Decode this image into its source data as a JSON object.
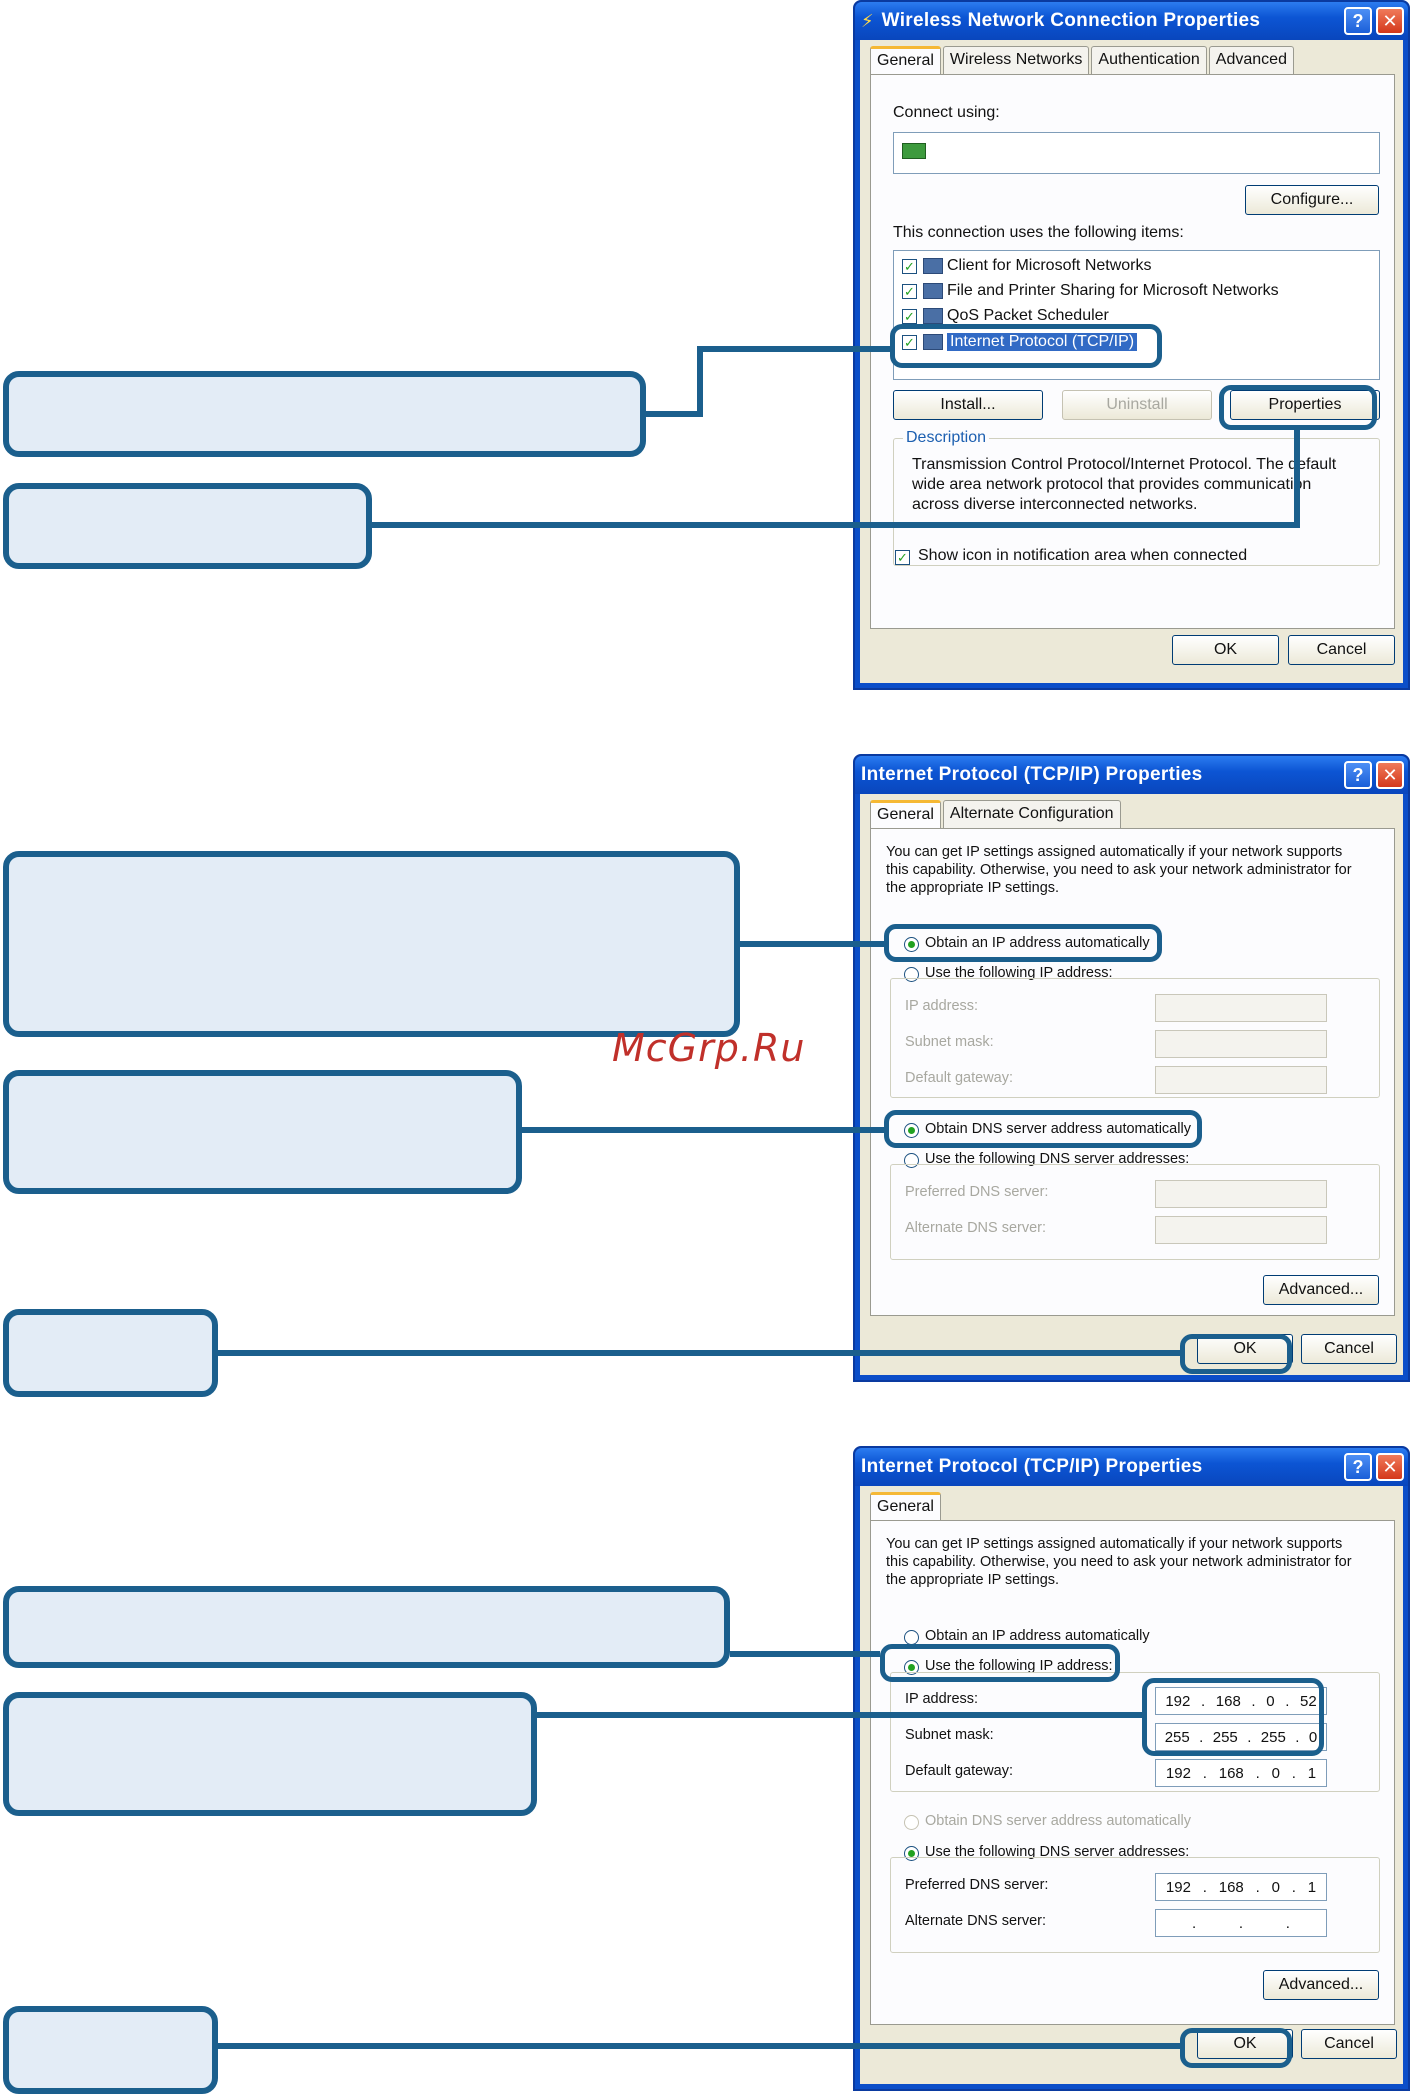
{
  "colors": {
    "callout_fill": "#e3ecf6",
    "callout_border": "#1b5f8d",
    "xp_title": "#0c55d4",
    "dialog_bg": "#ece9d8",
    "watermark": "#c0302a"
  },
  "watermark": "McGrp.Ru",
  "dialog1": {
    "title": "Wireless Network Connection Properties",
    "title_icon": "network-connection-icon",
    "tabs": [
      "General",
      "Wireless Networks",
      "Authentication",
      "Advanced"
    ],
    "connect_using_label": "Connect using:",
    "configure_button": "Configure...",
    "items_label": "This connection uses the following items:",
    "items": [
      {
        "label": "Client for Microsoft Networks",
        "checked": true,
        "selected": false
      },
      {
        "label": "File and Printer Sharing for Microsoft Networks",
        "checked": true,
        "selected": false
      },
      {
        "label": "QoS Packet Scheduler",
        "checked": true,
        "selected": false
      },
      {
        "label": "Internet Protocol (TCP/IP)",
        "checked": true,
        "selected": true
      }
    ],
    "install_button": "Install...",
    "uninstall_button": "Uninstall",
    "properties_button": "Properties",
    "description_label": "Description",
    "description_lines": [
      "Transmission Control Protocol/Internet Protocol. The default",
      "wide area network protocol that provides communication",
      "across diverse interconnected networks."
    ],
    "show_icon_label": "Show icon in notification area when connected",
    "show_icon_checked": true,
    "ok_button": "OK",
    "cancel_button": "Cancel"
  },
  "dialog2": {
    "title": "Internet Protocol (TCP/IP) Properties",
    "tabs": [
      "General",
      "Alternate Configuration"
    ],
    "intro_lines": [
      "You can get IP settings assigned automatically if your network supports",
      "this capability. Otherwise, you need to ask your network administrator for",
      "the appropriate IP settings."
    ],
    "obtain_ip_auto": "Obtain an IP address automatically",
    "use_following_ip": "Use the following IP address:",
    "ip_address_label": "IP address:",
    "subnet_mask_label": "Subnet mask:",
    "default_gateway_label": "Default gateway:",
    "obtain_dns_auto": "Obtain DNS server address automatically",
    "use_following_dns": "Use the following DNS server addresses:",
    "preferred_dns_label": "Preferred DNS server:",
    "alternate_dns_label": "Alternate DNS server:",
    "advanced_button": "Advanced...",
    "ok_button": "OK",
    "cancel_button": "Cancel"
  },
  "dialog3": {
    "title": "Internet Protocol (TCP/IP) Properties",
    "tabs": [
      "General"
    ],
    "intro_lines": [
      "You can get IP settings assigned automatically if your network supports",
      "this capability. Otherwise, you need to ask your network administrator for",
      "the appropriate IP settings."
    ],
    "obtain_ip_auto": "Obtain an IP address automatically",
    "use_following_ip": "Use the following IP address:",
    "ip_address_label": "IP address:",
    "ip_address_value": [
      "192",
      "168",
      "0",
      "52"
    ],
    "subnet_mask_label": "Subnet mask:",
    "subnet_mask_value": [
      "255",
      "255",
      "255",
      "0"
    ],
    "default_gateway_label": "Default gateway:",
    "default_gateway_value": [
      "192",
      "168",
      "0",
      "1"
    ],
    "obtain_dns_auto": "Obtain DNS server address automatically",
    "use_following_dns": "Use the following DNS server addresses:",
    "preferred_dns_label": "Preferred DNS server:",
    "preferred_dns_value": [
      "192",
      "168",
      "0",
      "1"
    ],
    "alternate_dns_label": "Alternate DNS server:",
    "alternate_dns_value": [
      "",
      "",
      "",
      ""
    ],
    "advanced_button": "Advanced...",
    "ok_button": "OK",
    "cancel_button": "Cancel"
  }
}
